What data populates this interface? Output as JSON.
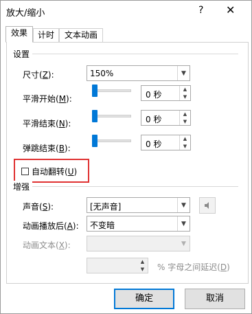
{
  "window": {
    "title": "放大/缩小",
    "help_glyph": "?",
    "close_glyph": "✕"
  },
  "tabs": [
    {
      "label": "效果",
      "active": true
    },
    {
      "label": "计时",
      "active": false
    },
    {
      "label": "文本动画",
      "active": false
    }
  ],
  "settings": {
    "title": "设置",
    "size": {
      "label_pre": "尺寸(",
      "hotkey": "Z",
      "label_post": "):",
      "value": "150%"
    },
    "smooth_start": {
      "label_pre": "平滑开始(",
      "hotkey": "M",
      "label_post": "):",
      "value": "0 秒"
    },
    "smooth_end": {
      "label_pre": "平滑结束(",
      "hotkey": "N",
      "label_post": "):",
      "value": "0 秒"
    },
    "bounce_end": {
      "label_pre": "弹跳结束(",
      "hotkey": "B",
      "label_post": "):",
      "value": "0 秒"
    },
    "auto_reverse": {
      "label_pre": "自动翻转(",
      "hotkey": "U",
      "label_post": ")",
      "checked": false
    }
  },
  "enhancements": {
    "title": "增强",
    "sound": {
      "label_pre": "声音(",
      "hotkey": "S",
      "label_post": "):",
      "value": "[无声音]"
    },
    "after_animation": {
      "label_pre": "动画播放后(",
      "hotkey": "A",
      "label_post": "):",
      "value": "不变暗"
    },
    "animate_text": {
      "label_pre": "动画文本(",
      "hotkey": "X",
      "label_post": "):",
      "value": "",
      "disabled": true
    },
    "letter_delay": {
      "value": "",
      "text_pre": "% 字母之间延迟(",
      "hotkey": "D",
      "text_post": ")",
      "disabled": true
    }
  },
  "buttons": {
    "ok": "确定",
    "cancel": "取消"
  },
  "colors": {
    "accent": "#0078d7",
    "highlight": "#e03131"
  },
  "icons": {
    "speaker": "speaker-icon",
    "dropdown": "chevron-down-icon"
  }
}
